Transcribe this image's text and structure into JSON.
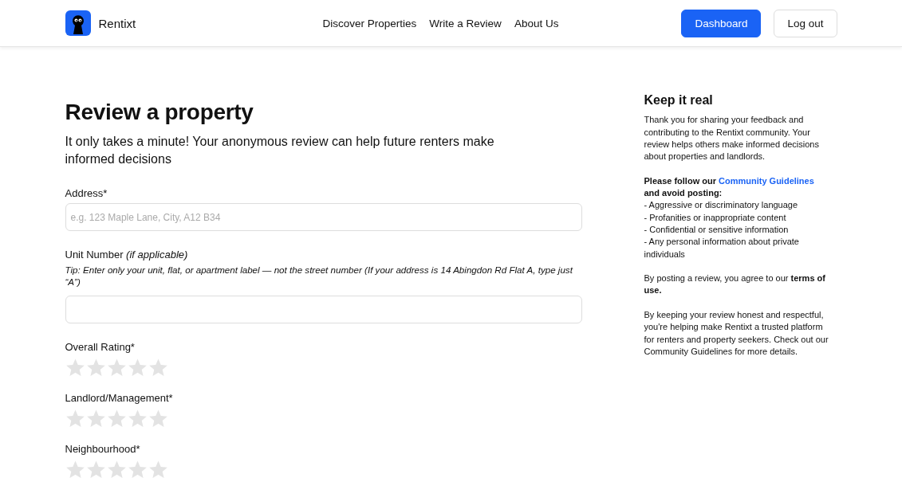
{
  "header": {
    "brand": "Rentixt",
    "nav": [
      {
        "label": "Discover Properties"
      },
      {
        "label": "Write a Review"
      },
      {
        "label": "About Us"
      }
    ],
    "buttons": [
      {
        "label": "Dashboard",
        "kind": "primary"
      },
      {
        "label": "Log out",
        "kind": "outline"
      }
    ]
  },
  "form": {
    "title": "Review a property",
    "subtitle": "It only takes a minute! Your anonymous review can help future renters make informed decisions",
    "fields": [
      {
        "kind": "text",
        "label": "Address*",
        "placeholder": "e.g. 123 Maple Lane, City, A12 B34"
      },
      {
        "kind": "text",
        "label": "Unit Number",
        "note": "(if applicable)",
        "tip": "Tip: Enter only your unit, flat, or apartment label — not the street number (If your address is 14 Abingdon Rd Flat A, type just “A”)"
      },
      {
        "kind": "rating",
        "label": "Overall Rating*",
        "stars": 0
      },
      {
        "kind": "rating",
        "label": "Landlord/Management*",
        "stars": 0
      },
      {
        "kind": "rating",
        "label": "Neighbourhood*",
        "stars": 0
      }
    ]
  },
  "sidebar": {
    "title": "Keep it real",
    "blocks": [
      {
        "kind": "paragraph",
        "text": "Thank you for sharing your feedback and contributing to the Rentixt community. Your review helps others make informed decisions about properties and landlords."
      },
      {
        "kind": "guidelines",
        "lead": "Please follow our",
        "link": "Community Guidelines",
        "tail": "and avoid posting:",
        "items": [
          "- Aggressive or discriminatory language",
          "- Profanities or inappropriate content",
          "- Confidential or sensitive information",
          "- Any personal information about private individuals"
        ]
      },
      {
        "kind": "paragraph",
        "text": "By posting a review, you agree to our **terms of use.**"
      },
      {
        "kind": "paragraph",
        "text": "By keeping your review honest and respectful, you're helping make Rentixt a trusted platform for renters and property seekers. Check out our Community Guidelines for more details."
      }
    ]
  }
}
